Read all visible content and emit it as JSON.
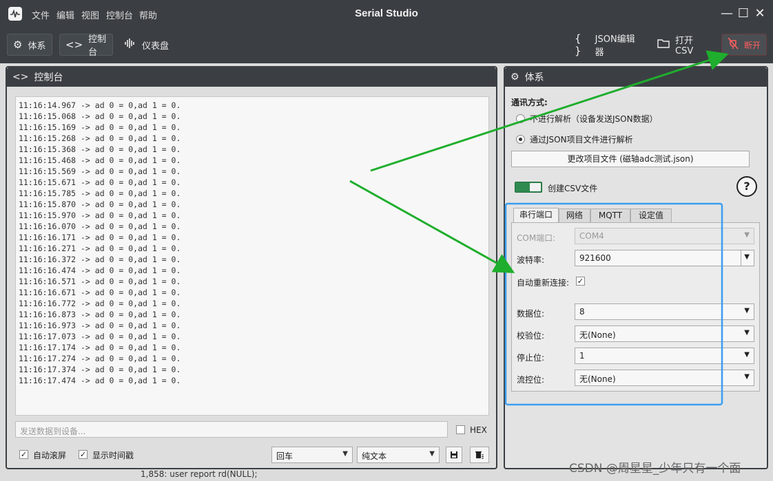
{
  "window": {
    "title": "Serial Studio",
    "minimize": "—",
    "maximize": "☐",
    "close": "✕"
  },
  "menu": [
    "文件",
    "编辑",
    "视图",
    "控制台",
    "帮助"
  ],
  "toolbar": {
    "setup_label": "体系",
    "console_label": "控制台",
    "dashboard_label": "仪表盘",
    "json_editor_label": "JSON编辑器",
    "open_csv_label": "打开CSV",
    "disconnect_label": "断开"
  },
  "console": {
    "title": "控制台",
    "lines": [
      "11:16:14.967 -> ad 0 = 0,ad 1 = 0.",
      "11:16:15.068 -> ad 0 = 0,ad 1 = 0.",
      "11:16:15.169 -> ad 0 = 0,ad 1 = 0.",
      "11:16:15.268 -> ad 0 = 0,ad 1 = 0.",
      "11:16:15.368 -> ad 0 = 0,ad 1 = 0.",
      "11:16:15.468 -> ad 0 = 0,ad 1 = 0.",
      "11:16:15.569 -> ad 0 = 0,ad 1 = 0.",
      "11:16:15.671 -> ad 0 = 0,ad 1 = 0.",
      "11:16:15.785 -> ad 0 = 0,ad 1 = 0.",
      "11:16:15.870 -> ad 0 = 0,ad 1 = 0.",
      "11:16:15.970 -> ad 0 = 0,ad 1 = 0.",
      "11:16:16.070 -> ad 0 = 0,ad 1 = 0.",
      "11:16:16.171 -> ad 0 = 0,ad 1 = 0.",
      "11:16:16.271 -> ad 0 = 0,ad 1 = 0.",
      "11:16:16.372 -> ad 0 = 0,ad 1 = 0.",
      "11:16:16.474 -> ad 0 = 0,ad 1 = 0.",
      "11:16:16.571 -> ad 0 = 0,ad 1 = 0.",
      "11:16:16.671 -> ad 0 = 0,ad 1 = 0.",
      "11:16:16.772 -> ad 0 = 0,ad 1 = 0.",
      "11:16:16.873 -> ad 0 = 0,ad 1 = 0.",
      "11:16:16.973 -> ad 0 = 0,ad 1 = 0.",
      "11:16:17.073 -> ad 0 = 0,ad 1 = 0.",
      "11:16:17.174 -> ad 0 = 0,ad 1 = 0.",
      "11:16:17.274 -> ad 0 = 0,ad 1 = 0.",
      "11:16:17.374 -> ad 0 = 0,ad 1 = 0.",
      "11:16:17.474 -> ad 0 = 0,ad 1 = 0."
    ],
    "send_placeholder": "发送数据到设备...",
    "hex_label": "HEX",
    "autoscroll_label": "自动滚屏",
    "autoscroll_checked": true,
    "timestamp_label": "显示时间戳",
    "timestamp_checked": true,
    "line_ending": "回车",
    "display_mode": "纯文本"
  },
  "setup": {
    "title": "体系",
    "comm_mode_label": "通讯方式:",
    "radio_no_parse": "不进行解析（设备发送JSON数据）",
    "radio_json_project": "通过JSON项目文件进行解析",
    "selected_radio": "json_project",
    "change_project_button": "更改项目文件 (磁轴adc测试.json)",
    "create_csv_label": "创建CSV文件",
    "create_csv_on": true,
    "help_symbol": "?",
    "tabs": [
      "串行端口",
      "网络",
      "MQTT",
      "设定值"
    ],
    "active_tab": 0,
    "serial": {
      "com_label": "COM端口:",
      "com_value": "COM4",
      "baud_label": "波特率:",
      "baud_value": "921600",
      "reconnect_label": "自动重新连接:",
      "reconnect_checked": true,
      "databits_label": "数据位:",
      "databits_value": "8",
      "parity_label": "校验位:",
      "parity_value": "无(None)",
      "stopbits_label": "停止位:",
      "stopbits_value": "1",
      "flow_label": "流控位:",
      "flow_value": "无(None)"
    }
  },
  "colors": {
    "accent_green": "#2f8a4f",
    "annotation_green": "#1fae2d",
    "annotation_blue": "#3a9ef0",
    "disconnect_red": "#ff5e5e"
  },
  "watermark": "CSDN @周星星_少年只有一个面",
  "background_code": "1,858: user report rd(NULL);"
}
